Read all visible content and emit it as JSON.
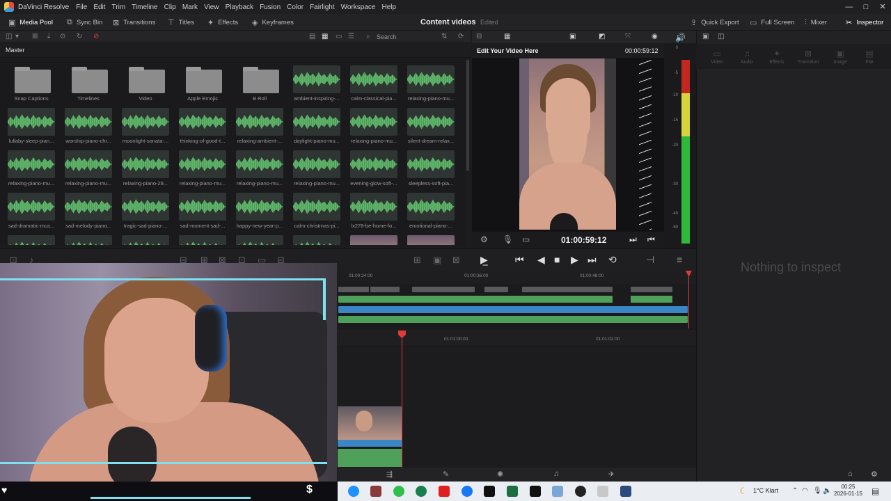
{
  "menubar": {
    "app_name": "DaVinci Resolve",
    "items": [
      "File",
      "Edit",
      "Trim",
      "Timeline",
      "Clip",
      "Mark",
      "View",
      "Playback",
      "Fusion",
      "Color",
      "Fairlight",
      "Workspace",
      "Help"
    ],
    "win_min": "—",
    "win_max": "□",
    "win_close": "✕"
  },
  "toolbar": {
    "media_pool": "Media Pool",
    "sync_bin": "Sync Bin",
    "transitions": "Transitions",
    "titles": "Titles",
    "effects": "Effects",
    "keyframes": "Keyframes",
    "project_title": "Content videos",
    "edited": "Edited",
    "quick_export": "Quick Export",
    "full_screen": "Full Screen",
    "mixer": "Mixer",
    "inspector": "Inspector"
  },
  "pool": {
    "search_placeholder": "Search",
    "bin_name": "Master",
    "clips": [
      {
        "label": "Snap Captions",
        "kind": "folder"
      },
      {
        "label": "Timelines",
        "kind": "folder"
      },
      {
        "label": "Video",
        "kind": "folder"
      },
      {
        "label": "Apple Emojis",
        "kind": "folder"
      },
      {
        "label": "B Roll",
        "kind": "folder"
      },
      {
        "label": "ambient-inspiring-...",
        "kind": "wave"
      },
      {
        "label": "calm-classical-pia...",
        "kind": "wave"
      },
      {
        "label": "relaxing-piano-mu...",
        "kind": "wave"
      },
      {
        "label": "lullaby-sleep-pian...",
        "kind": "wave"
      },
      {
        "label": "worship-piano-chr...",
        "kind": "wave"
      },
      {
        "label": "moonlight-sonata-...",
        "kind": "wave"
      },
      {
        "label": "thinking-of-good-t...",
        "kind": "wave"
      },
      {
        "label": "relaxing-ambient-...",
        "kind": "wave"
      },
      {
        "label": "daylight-piano-mu...",
        "kind": "wave"
      },
      {
        "label": "relaxing-piano-mu...",
        "kind": "wave"
      },
      {
        "label": "silent-dream-relax...",
        "kind": "wave"
      },
      {
        "label": "relaxing-piano-mu...",
        "kind": "wave"
      },
      {
        "label": "relaxing-piano-mu...",
        "kind": "wave"
      },
      {
        "label": "relaxing-piano-29...",
        "kind": "wave"
      },
      {
        "label": "relaxing-piano-mu...",
        "kind": "wave"
      },
      {
        "label": "relaxing-piano-mu...",
        "kind": "wave"
      },
      {
        "label": "relaxing-piano-mu...",
        "kind": "wave"
      },
      {
        "label": "evening-glow-soft-...",
        "kind": "wave"
      },
      {
        "label": "sleepless-soft-pia...",
        "kind": "wave"
      },
      {
        "label": "sad-dramatic-mus...",
        "kind": "wave"
      },
      {
        "label": "sad-melody-piano...",
        "kind": "wave"
      },
      {
        "label": "tragic-sad-piano-...",
        "kind": "wave"
      },
      {
        "label": "sad-moment-sad-...",
        "kind": "wave"
      },
      {
        "label": "happy-new-year-p...",
        "kind": "wave"
      },
      {
        "label": "calm-christmas-pi...",
        "kind": "wave"
      },
      {
        "label": "lx278-be-home-fo...",
        "kind": "wave"
      },
      {
        "label": "emotional-piano-...",
        "kind": "wave"
      },
      {
        "label": "",
        "kind": "wave"
      },
      {
        "label": "",
        "kind": "wave"
      },
      {
        "label": "",
        "kind": "wave"
      },
      {
        "label": "",
        "kind": "wave"
      },
      {
        "label": "",
        "kind": "wave"
      },
      {
        "label": "",
        "kind": "wave"
      },
      {
        "label": "",
        "kind": "face"
      },
      {
        "label": "",
        "kind": "face"
      }
    ]
  },
  "viewer": {
    "title": "Edit Your Video Here",
    "timecode_top": "00:00:59:12",
    "timecode": "01:00:59:12"
  },
  "meter": {
    "scale": [
      "0",
      "-5",
      "-10",
      "-15",
      "-20",
      "-30",
      "-40",
      "-50"
    ]
  },
  "inspector": {
    "tabs": [
      "Video",
      "Audio",
      "Effects",
      "Transition",
      "Image",
      "File"
    ],
    "empty": "Nothing to inspect"
  },
  "timeline": {
    "ruler_top": [
      "01:00:24:00",
      "01:00:36:00",
      "01:00:48:00"
    ],
    "ruler_bottom": [
      "01:01:00:00",
      "01:01:02:00"
    ]
  },
  "taskbar": {
    "weather": "1°C  Klart",
    "time": "00:25",
    "date": "2026-01-15"
  },
  "colors": {
    "accent_red": "#e03a3a",
    "clip_green": "#4fa05a",
    "clip_blue": "#3b86c4",
    "overlay_cyan": "#7fe0f0"
  }
}
